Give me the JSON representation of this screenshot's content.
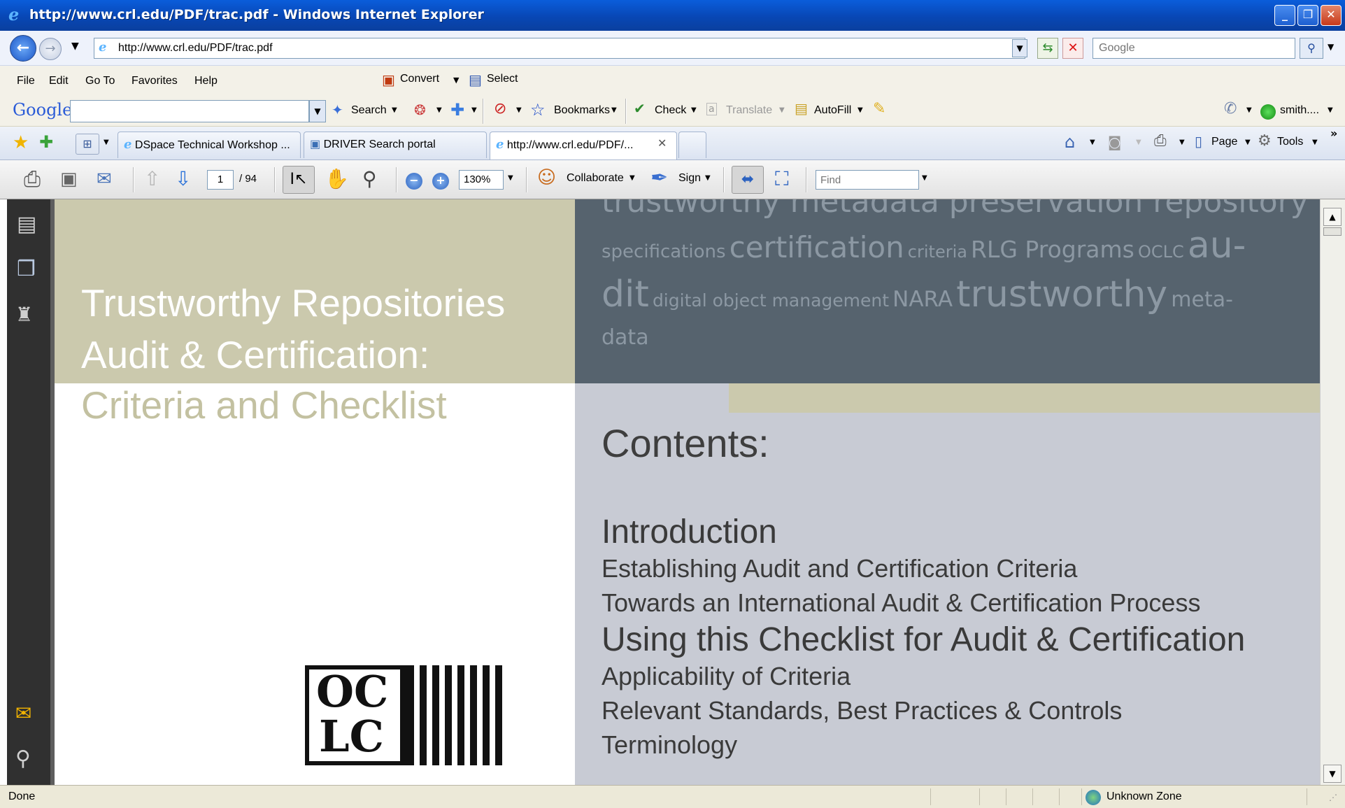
{
  "window": {
    "title": "http://www.crl.edu/PDF/trac.pdf - Windows Internet Explorer",
    "controls": [
      "_",
      "❐",
      "✕"
    ]
  },
  "address": {
    "url": "http://www.crl.edu/PDF/trac.pdf",
    "search_placeholder": "Google"
  },
  "menu": {
    "items": [
      "File",
      "Edit",
      "Go To",
      "Favorites",
      "Help"
    ],
    "convert_label": "Convert",
    "select_label": "Select"
  },
  "google_toolbar": {
    "brand": "Google",
    "search_label": "Search",
    "bookmarks_label": "Bookmarks",
    "check_label": "Check",
    "translate_label": "Translate",
    "autofill_label": "AutoFill",
    "account_label": "smith...."
  },
  "tabs": [
    {
      "label": "DSpace Technical Workshop ..."
    },
    {
      "label": "DRIVER Search portal"
    },
    {
      "label": "http://www.crl.edu/PDF/..."
    }
  ],
  "command_bar": {
    "page_label": "Page",
    "tools_label": "Tools"
  },
  "pdf_toolbar": {
    "current_page": "1",
    "total_pages": "/ 94",
    "zoom": "130%",
    "collaborate_label": "Collaborate",
    "sign_label": "Sign",
    "find_placeholder": "Find"
  },
  "document": {
    "title_line1": "Trustworthy Repositories",
    "title_line2": "Audit & Certification:",
    "subtitle": "Criteria and Checklist",
    "cloud_line0": "trustworthy metadata preservation repository CRL",
    "cloud_line1a": "specifications",
    "cloud_line1b": "certification",
    "cloud_line1c": "criteria",
    "cloud_line1d": "RLG Programs",
    "cloud_line1e": "OCLC",
    "cloud_line1f": "au-",
    "cloud_line2a": "dit",
    "cloud_line2b": "digital object management",
    "cloud_line2c": "NARA",
    "cloud_line2d": "trustworthy",
    "cloud_line2e": "meta-",
    "cloud_line3": "data",
    "contents_heading": "Contents:",
    "toc": [
      "Introduction",
      "Establishing Audit and Certification Criteria",
      "Towards an International Audit & Certification Process",
      "Using this Checklist for Audit & Certification",
      "Applicability of Criteria",
      "Relevant Standards, Best Practices & Controls",
      "Terminology"
    ],
    "logo_text_top": "OC",
    "logo_text_bottom": "LC"
  },
  "status": {
    "left": "Done",
    "zone": "Unknown Zone"
  },
  "colors": {
    "khaki": "#cbc9ad",
    "slate": "#56636e",
    "toc_bg": "#c8cbd4",
    "cloud_text": "#8c98a3"
  }
}
